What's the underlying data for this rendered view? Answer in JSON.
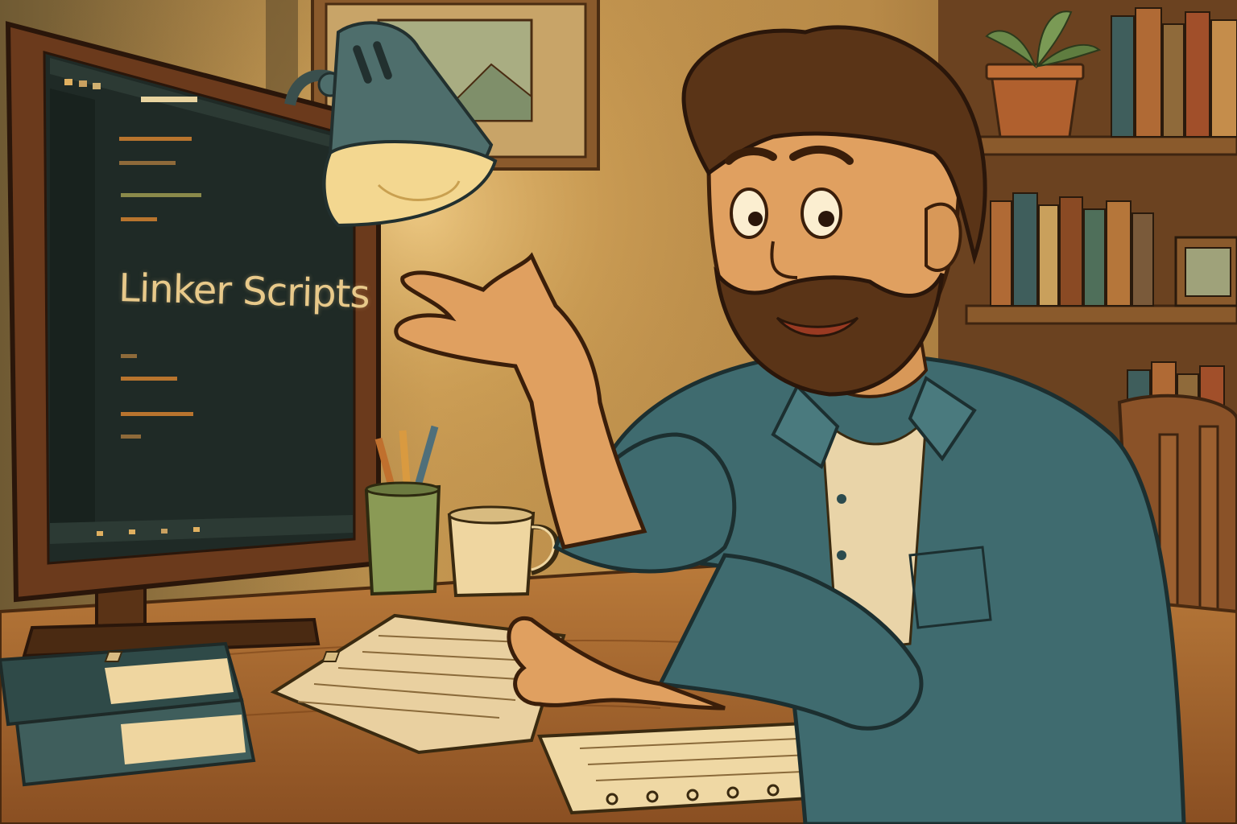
{
  "screen": {
    "title": "Linker Scripts"
  },
  "palette": {
    "wall": "#c99b52",
    "shelf": "#7a4f26",
    "desk": "#a9672e",
    "monitor_frame": "#6b3a1c",
    "screen_bg": "#1f2a26",
    "shirt": "#3f6b6f",
    "skin": "#e0a060",
    "hair": "#5a3417",
    "lamp": "#4e6e6c",
    "screen_text": "#e8c98a"
  },
  "icons": {
    "monitor": "monitor-icon",
    "lamp": "desk-lamp-icon",
    "keyboard": "keyboard-icon",
    "mug": "coffee-mug-icon",
    "pencils": "pencil-cup-icon",
    "notebook": "notebook-icon",
    "books": "book-stack-icon",
    "plant": "potted-plant-icon"
  }
}
